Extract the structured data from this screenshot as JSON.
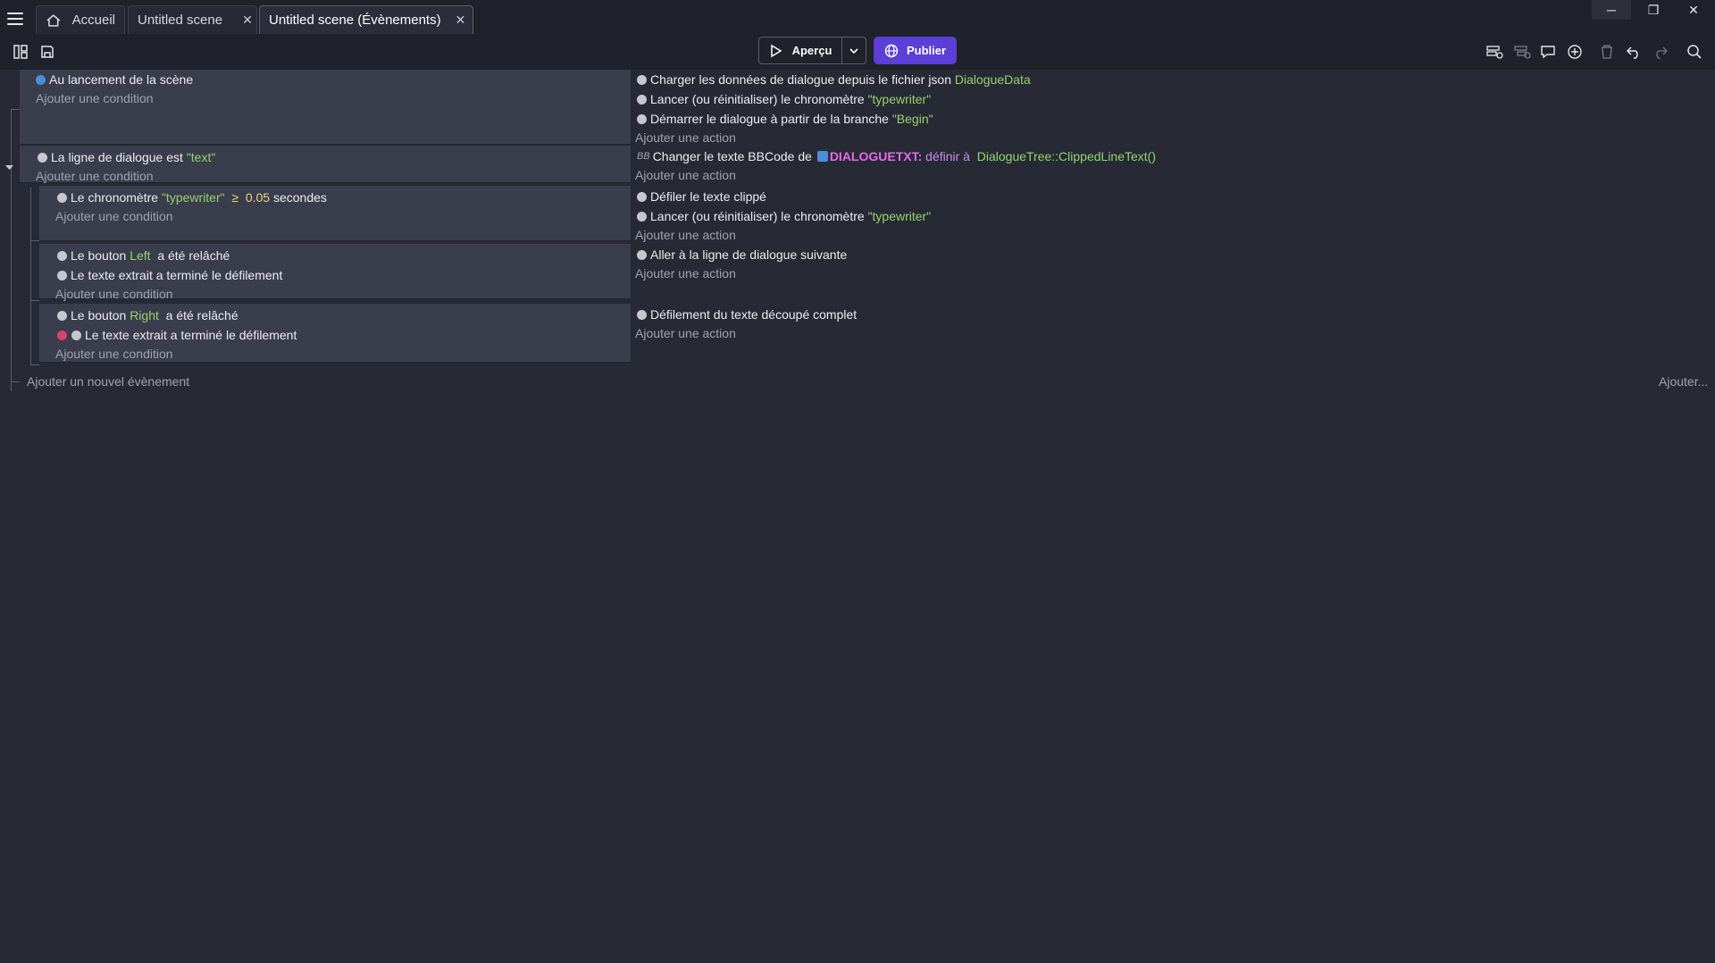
{
  "tabs": [
    {
      "label": "Accueil"
    },
    {
      "label": "Untitled scene"
    },
    {
      "label": "Untitled scene (Évènements)"
    }
  ],
  "toolbar": {
    "preview_label": "Aperçu",
    "publish_label": "Publier"
  },
  "colors": {
    "accent": "#5b3fd6",
    "string_value": "#95d36e",
    "number_value": "#e9d47c"
  },
  "events": {
    "e1": {
      "cond1": "Au lancement de la scène",
      "add_condition": "Ajouter une condition",
      "act1": {
        "text": "Charger les données de dialogue depuis le fichier json",
        "value": "DialogueData"
      },
      "act2": {
        "text": "Lancer (ou réinitialiser) le chronomètre",
        "value": "\"typewriter\""
      },
      "act3": {
        "text": "Démarrer le dialogue à partir de la branche",
        "value": "\"Begin\""
      },
      "add_action": "Ajouter une action"
    },
    "e2": {
      "cond1": {
        "text": "La ligne de dialogue est",
        "value": "\"text\""
      },
      "add_condition": "Ajouter une condition",
      "act1": {
        "text": "Changer le texte BBCode de",
        "object": "DIALOGUETXT:",
        "op": "définir à",
        "value": "DialogueTree::ClippedLineText()"
      },
      "add_action": "Ajouter une action"
    },
    "e3": {
      "cond1": {
        "text": "Le chronomètre",
        "value": "\"typewriter\"",
        "op": "≥",
        "num": "0.05",
        "suffix": "secondes"
      },
      "add_condition": "Ajouter une condition",
      "act1": "Défiler le texte clippé",
      "act2": {
        "text": "Lancer (ou réinitialiser) le chronomètre",
        "value": "\"typewriter\""
      },
      "add_action": "Ajouter une action"
    },
    "e4": {
      "cond1": {
        "text": "Le bouton",
        "value": "Left",
        "suffix": "a été relâché"
      },
      "cond2": "Le texte extrait a terminé le défilement",
      "add_condition": "Ajouter une condition",
      "act1": "Aller à la ligne de dialogue suivante",
      "add_action": "Ajouter une action"
    },
    "e5": {
      "cond1": {
        "text": "Le bouton",
        "value": "Right",
        "suffix": "a été relâché"
      },
      "cond2": "Le texte extrait a terminé le défilement",
      "add_condition": "Ajouter une condition",
      "act1": "Défilement du texte découpé complet",
      "add_action": "Ajouter une action"
    }
  },
  "footer": {
    "add_event": "Ajouter un nouvel évènement",
    "add_more": "Ajouter..."
  }
}
